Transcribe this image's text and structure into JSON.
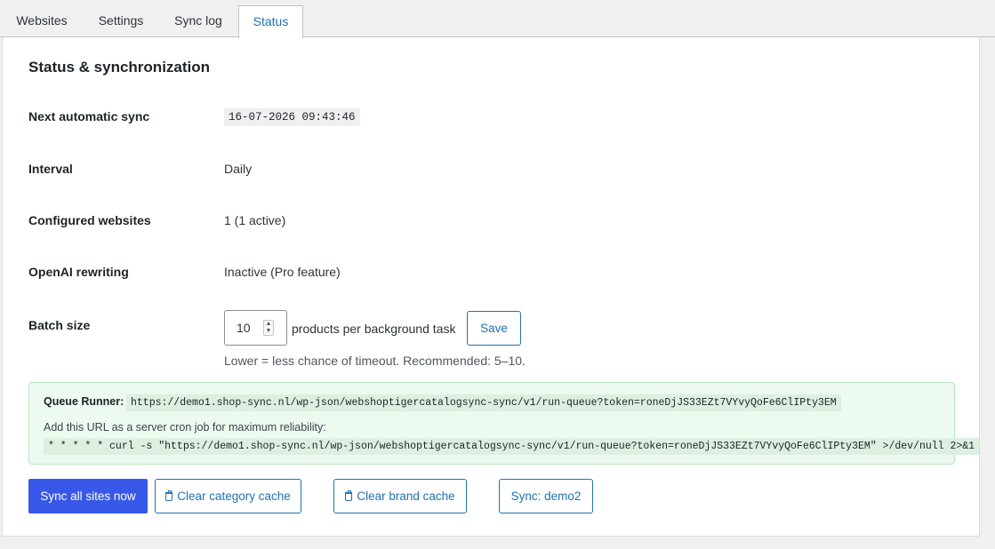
{
  "tabs": [
    {
      "label": "Websites"
    },
    {
      "label": "Settings"
    },
    {
      "label": "Sync log"
    },
    {
      "label": "Status",
      "active": true
    }
  ],
  "section_title": "Status & synchronization",
  "rows": {
    "next_sync": {
      "label": "Next automatic sync",
      "value": "16-07-2026 09:43:46"
    },
    "interval": {
      "label": "Interval",
      "value": "Daily"
    },
    "websites": {
      "label": "Configured websites",
      "value": "1 (1 active)"
    },
    "openai": {
      "label": "OpenAI rewriting",
      "value": "Inactive (Pro feature)"
    },
    "batch": {
      "label": "Batch size",
      "value": "10",
      "suffix": "products per background task",
      "save_label": "Save",
      "hint": "Lower = less chance of timeout. Recommended: 5–10."
    }
  },
  "queue_runner": {
    "label": "Queue Runner:",
    "url": "https://demo1.shop-sync.nl/wp-json/webshoptigercatalogsync-sync/v1/run-queue?token=roneDjJS33EZt7VYvyQoFe6ClIPty3EM",
    "cron_hint": "Add this URL as a server cron job for maximum reliability:",
    "cron_command": "* * * * * curl -s \"https://demo1.shop-sync.nl/wp-json/webshoptigercatalogsync-sync/v1/run-queue?token=roneDjJS33EZt7VYvyQoFe6ClIPty3EM\" >/dev/null 2>&1"
  },
  "actions": {
    "sync_all": "Sync all sites now",
    "clear_category": "Clear category cache",
    "clear_brand": "Clear brand cache",
    "sync_demo2": "Sync: demo2"
  },
  "colors": {
    "accent": "#2271b1",
    "primary_button": "#3858e9",
    "notice_background": "#edfaef",
    "notice_border": "#b8e6bf"
  },
  "icons": {
    "clear_cache": "trash-icon",
    "stepper": "spinner-icon"
  }
}
